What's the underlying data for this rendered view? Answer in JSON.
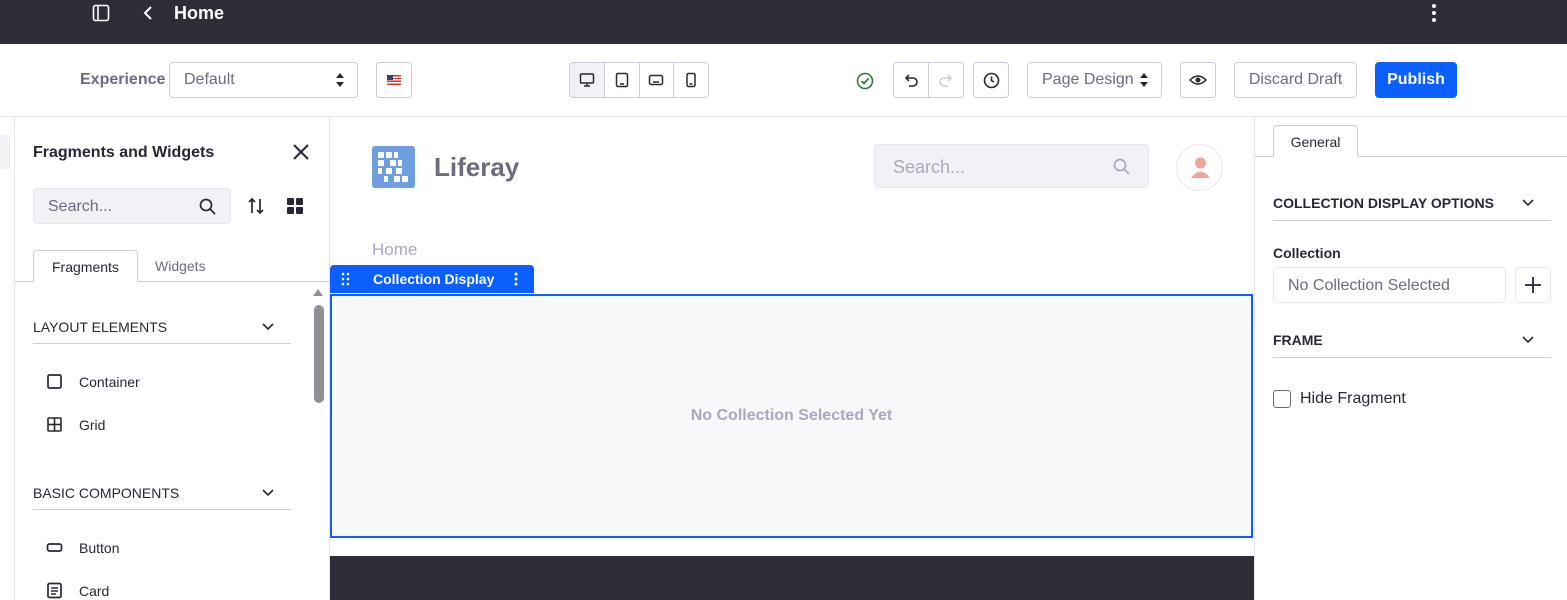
{
  "topbar": {
    "title": "Home"
  },
  "toolbar": {
    "experience_label": "Experience",
    "experience_value": "Default",
    "page_design_label": "Page Design",
    "discard_label": "Discard Draft",
    "publish_label": "Publish"
  },
  "left_panel": {
    "title": "Fragments and Widgets",
    "search_placeholder": "Search...",
    "tabs": [
      "Fragments",
      "Widgets"
    ],
    "sections": [
      {
        "label": "LAYOUT ELEMENTS",
        "items": [
          {
            "label": "Container",
            "icon": "container-icon"
          },
          {
            "label": "Grid",
            "icon": "grid-icon"
          }
        ]
      },
      {
        "label": "BASIC COMPONENTS",
        "items": [
          {
            "label": "Button",
            "icon": "button-icon"
          },
          {
            "label": "Card",
            "icon": "card-icon"
          }
        ]
      }
    ]
  },
  "canvas": {
    "brand": "Liferay",
    "search_placeholder": "Search...",
    "breadcrumb": "Home",
    "fragment_label": "Collection Display",
    "empty_message": "No Collection Selected Yet"
  },
  "right_panel": {
    "tab": "General",
    "section_collection": "COLLECTION DISPLAY OPTIONS",
    "collection_label": "Collection",
    "collection_value": "No Collection Selected",
    "section_frame": "FRAME",
    "hide_fragment_label": "Hide Fragment"
  },
  "colors": {
    "primary": "#0b5fff",
    "dark": "#2c2d37",
    "success": "#287d3c"
  }
}
